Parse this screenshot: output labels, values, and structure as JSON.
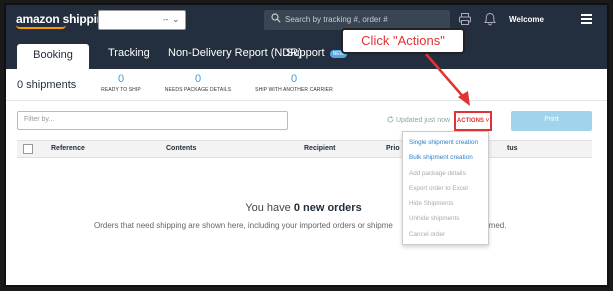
{
  "topbar": {
    "logo": "amazon shipping",
    "account_selector_value": "--",
    "search_placeholder": "Search by tracking #, order #",
    "welcome": "Welcome"
  },
  "tabs": [
    {
      "label": "Booking",
      "active": true
    },
    {
      "label": "Tracking"
    },
    {
      "label": "Non-Delivery Report (NDR)"
    },
    {
      "label": "Support",
      "badge": "NEW"
    }
  ],
  "annotation": {
    "text": "Click \"Actions\"",
    "color": "#e03333"
  },
  "summary": {
    "shipments": "0 shipments",
    "stats": [
      {
        "value": "0",
        "label": "READY TO SHIP"
      },
      {
        "value": "0",
        "label": "NEEDS PACKAGE DETAILS"
      },
      {
        "value": "0",
        "label": "SHIP WITH ANOTHER CARRIER"
      }
    ]
  },
  "toolbar": {
    "filter_placeholder": "Filter by...",
    "updated": "Updated just now",
    "actions": "ACTIONS",
    "print": "Print"
  },
  "table": {
    "headers": [
      "Reference",
      "Contents",
      "Recipient",
      "Prio",
      "tus"
    ]
  },
  "empty_state": {
    "prefix": "You have ",
    "count": "0 new orders",
    "description": "Orders that need shipping are shown here, including your imported orders or shipme",
    "description_tail": "rmed."
  },
  "actions_menu": [
    {
      "label": "Single shipment creation",
      "enabled": true
    },
    {
      "label": "Bulk shipment creation",
      "enabled": true
    },
    {
      "label": "Add package details",
      "enabled": false
    },
    {
      "label": "Export order to Excel",
      "enabled": false
    },
    {
      "label": "Hide Shipments",
      "enabled": false
    },
    {
      "label": "Unhide shipments",
      "enabled": false
    },
    {
      "label": "Cancel order",
      "enabled": false
    }
  ],
  "colors": {
    "navy": "#232f3e",
    "accent": "#f90",
    "link": "#2c7fc4",
    "highlight": "#e03333"
  }
}
